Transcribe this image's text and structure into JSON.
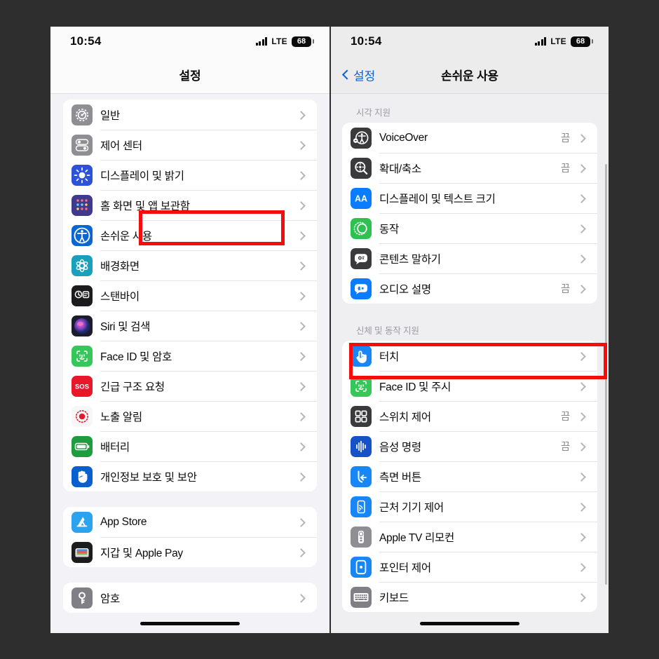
{
  "background_color": "#2e2e2e",
  "highlight_color": "#f50d0d",
  "left_phone": {
    "status": {
      "time": "10:54",
      "network": "LTE",
      "battery": "68"
    },
    "nav": {
      "title": "설정"
    },
    "groups": [
      {
        "items": [
          {
            "label": "일반",
            "value": "",
            "icon": "gear-icon",
            "icon_bg": "#8e8e93",
            "highlighted": false
          },
          {
            "label": "제어 센터",
            "value": "",
            "icon": "control-center-icon",
            "icon_bg": "#8e8e93",
            "highlighted": false
          },
          {
            "label": "디스플레이 및 밝기",
            "value": "",
            "icon": "brightness-icon",
            "icon_bg": "#2c52d8",
            "highlighted": false
          },
          {
            "label": "홈 화면 및 앱 보관함",
            "value": "",
            "icon": "home-screen-icon",
            "icon_bg": "#3f3a8c",
            "highlighted": false
          },
          {
            "label": "손쉬운 사용",
            "value": "",
            "icon": "accessibility-icon",
            "icon_bg": "#0a66d0",
            "highlighted": true
          },
          {
            "label": "배경화면",
            "value": "",
            "icon": "wallpaper-icon",
            "icon_bg": "#19a0bb",
            "highlighted": false
          },
          {
            "label": "스탠바이",
            "value": "",
            "icon": "standby-icon",
            "icon_bg": "#1c1c1e",
            "highlighted": false
          },
          {
            "label": "Siri 및 검색",
            "value": "",
            "icon": "siri-icon",
            "icon_bg": "#1c1c2e",
            "highlighted": false
          },
          {
            "label": "Face ID 및 암호",
            "value": "",
            "icon": "faceid-icon",
            "icon_bg": "#35c759",
            "highlighted": false
          },
          {
            "label": "긴급 구조 요청",
            "value": "",
            "icon": "sos-icon",
            "icon_bg": "#e8182a",
            "highlighted": false
          },
          {
            "label": "노출 알림",
            "value": "",
            "icon": "exposure-notification-icon",
            "icon_bg": "#f7f7f7",
            "highlighted": false
          },
          {
            "label": "배터리",
            "value": "",
            "icon": "battery-icon",
            "icon_bg": "#1f9d3e",
            "highlighted": false
          },
          {
            "label": "개인정보 보호 및 보안",
            "value": "",
            "icon": "privacy-hand-icon",
            "icon_bg": "#0a5fd0",
            "highlighted": false
          }
        ]
      },
      {
        "items": [
          {
            "label": "App Store",
            "value": "",
            "icon": "app-store-icon",
            "icon_bg": "#2da2ef",
            "highlighted": false
          },
          {
            "label": "지갑 및 Apple Pay",
            "value": "",
            "icon": "wallet-icon",
            "icon_bg": "#1c1c1e",
            "highlighted": false
          }
        ]
      },
      {
        "items": [
          {
            "label": "암호",
            "value": "",
            "icon": "passwords-key-icon",
            "icon_bg": "#7f7f85",
            "highlighted": false
          }
        ]
      }
    ]
  },
  "right_phone": {
    "status": {
      "time": "10:54",
      "network": "LTE",
      "battery": "68"
    },
    "nav": {
      "back_label": "설정",
      "title": "손쉬운 사용"
    },
    "sections": [
      {
        "label": "시각 지원",
        "items": [
          {
            "label": "VoiceOver",
            "value": "끔",
            "icon": "voiceover-icon",
            "icon_bg": "#3a3a3c",
            "highlighted": false
          },
          {
            "label": "확대/축소",
            "value": "끔",
            "icon": "zoom-magnifier-icon",
            "icon_bg": "#3a3a3c",
            "highlighted": false
          },
          {
            "label": "디스플레이 및 텍스트 크기",
            "value": "",
            "icon": "display-text-size-icon",
            "icon_bg": "#0a7cff",
            "highlighted": false
          },
          {
            "label": "동작",
            "value": "",
            "icon": "motion-icon",
            "icon_bg": "#2fc150",
            "highlighted": false
          },
          {
            "label": "콘텐츠 말하기",
            "value": "",
            "icon": "spoken-content-icon",
            "icon_bg": "#3a3a3c",
            "highlighted": false
          },
          {
            "label": "오디오 설명",
            "value": "끔",
            "icon": "audio-descriptions-icon",
            "icon_bg": "#0a7cff",
            "highlighted": false
          }
        ]
      },
      {
        "label": "신체 및 동작 지원",
        "items": [
          {
            "label": "터치",
            "value": "",
            "icon": "touch-icon",
            "icon_bg": "#1887f5",
            "highlighted": true
          },
          {
            "label": "Face ID 및 주시",
            "value": "",
            "icon": "faceid-attention-icon",
            "icon_bg": "#35c759",
            "highlighted": false
          },
          {
            "label": "스위치 제어",
            "value": "끔",
            "icon": "switch-control-icon",
            "icon_bg": "#3a3a3c",
            "highlighted": false
          },
          {
            "label": "음성 명령",
            "value": "끔",
            "icon": "voice-control-icon",
            "icon_bg": "#1552c8",
            "highlighted": false
          },
          {
            "label": "측면 버튼",
            "value": "",
            "icon": "side-button-icon",
            "icon_bg": "#1887f5",
            "highlighted": false
          },
          {
            "label": "근처 기기 제어",
            "value": "",
            "icon": "nearby-device-control-icon",
            "icon_bg": "#1887f5",
            "highlighted": false
          },
          {
            "label": "Apple TV 리모컨",
            "value": "",
            "icon": "apple-tv-remote-icon",
            "icon_bg": "#8e8e93",
            "highlighted": false
          },
          {
            "label": "포인터 제어",
            "value": "",
            "icon": "pointer-control-icon",
            "icon_bg": "#1887f5",
            "highlighted": false
          },
          {
            "label": "키보드",
            "value": "",
            "icon": "keyboard-icon",
            "icon_bg": "#7f7f85",
            "highlighted": false
          }
        ]
      }
    ]
  }
}
